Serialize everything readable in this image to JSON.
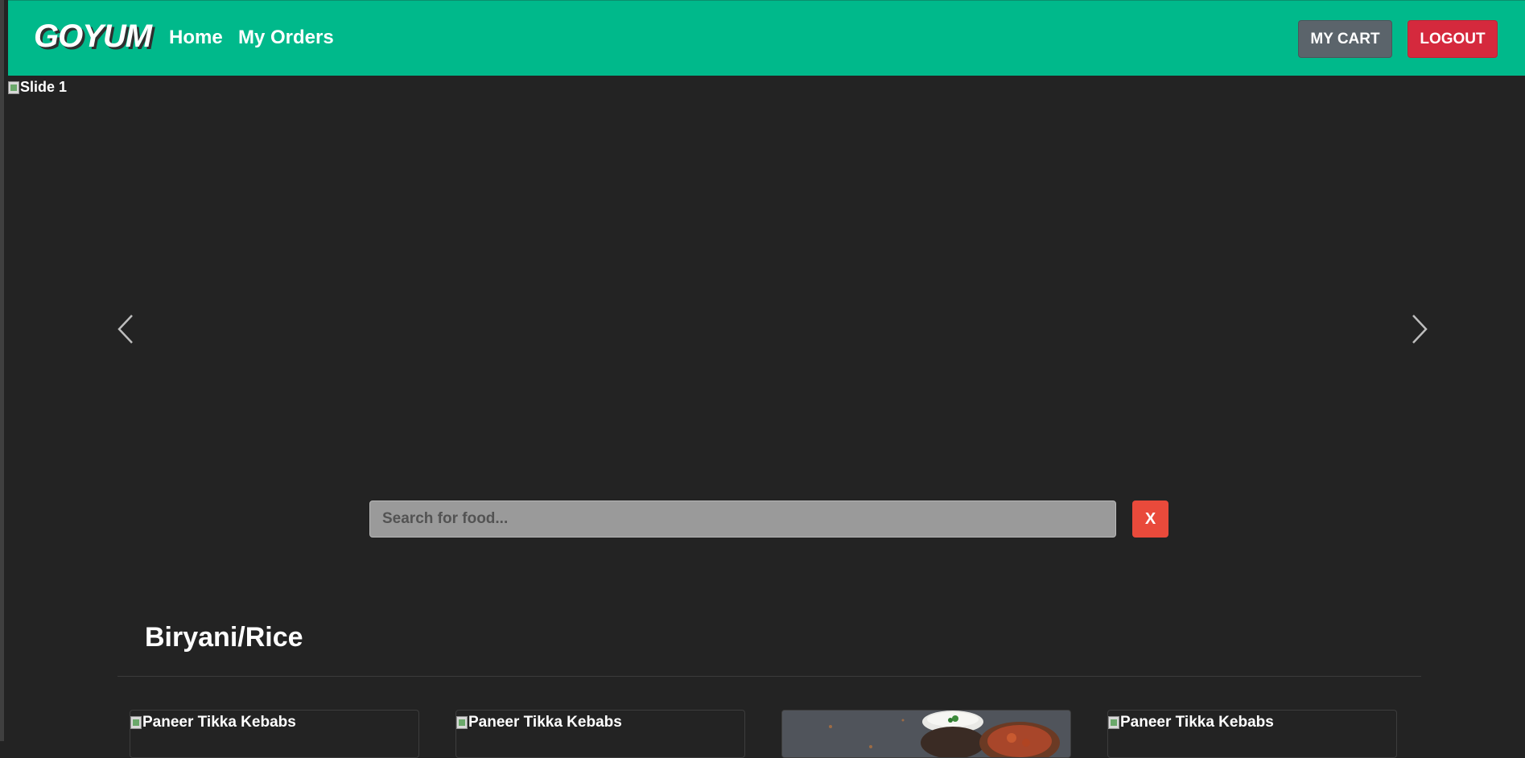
{
  "navbar": {
    "brand": "GOYUM",
    "links": [
      "Home",
      "My Orders"
    ],
    "cart_label": "MY CART",
    "logout_label": "LOGOUT",
    "background": "#00b98b"
  },
  "carousel": {
    "slide_alt": "Slide 1",
    "prev_icon": "chevron-left-icon",
    "next_icon": "chevron-right-icon"
  },
  "search": {
    "placeholder": "Search for food...",
    "value": "",
    "clear_label": "X"
  },
  "section": {
    "title": "Biryani/Rice",
    "cards": [
      {
        "alt": "Paneer Tikka Kebabs",
        "image_loaded": false
      },
      {
        "alt": "Paneer Tikka Kebabs",
        "image_loaded": false
      },
      {
        "alt": "",
        "image_loaded": true
      },
      {
        "alt": "Paneer Tikka Kebabs",
        "image_loaded": false
      }
    ]
  },
  "colors": {
    "page_bg": "#232323",
    "cart_button": "#5b646b",
    "logout_button": "#d5293d",
    "clear_button": "#e94a3b"
  }
}
